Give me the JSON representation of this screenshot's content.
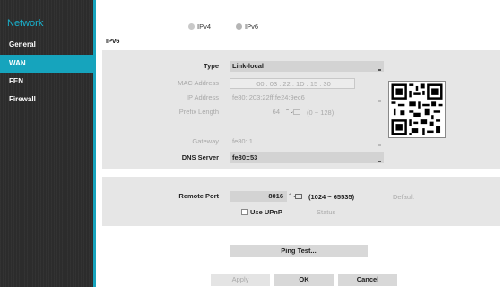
{
  "sidebar": {
    "title": "Network",
    "items": [
      {
        "label": "General"
      },
      {
        "label": "WAN"
      },
      {
        "label": "FEN"
      },
      {
        "label": "Firewall"
      }
    ]
  },
  "tabs": [
    {
      "label": "IPv4",
      "selected": false
    },
    {
      "label": "IPv6",
      "selected": true
    }
  ],
  "section_label": "IPv6",
  "form": {
    "type": {
      "label": "Type",
      "value": "Link-local"
    },
    "mac": {
      "label": "MAC Address",
      "value": "00 : 03 : 22 : 1D : 15 : 30"
    },
    "ip": {
      "label": "IP Address",
      "value": "fe80::203:22ff:fe24:9ec6"
    },
    "prefix": {
      "label": "Prefix Length",
      "value": "64",
      "range": "(0 ~ 128)"
    },
    "gateway": {
      "label": "Gateway",
      "value": "fe80::1"
    },
    "dns": {
      "label": "DNS Server",
      "value": "fe80::53"
    }
  },
  "remote": {
    "label": "Remote Port",
    "value": "8016",
    "range": "(1024 ~ 65535)",
    "default_label": "Default",
    "upnp_label": "Use UPnP",
    "status_label": "Status"
  },
  "buttons": {
    "ping": "Ping Test...",
    "apply": "Apply",
    "ok": "OK",
    "cancel": "Cancel"
  },
  "colors": {
    "accent": "#16a4bd",
    "sidebar_bg": "#2c2c2c"
  }
}
